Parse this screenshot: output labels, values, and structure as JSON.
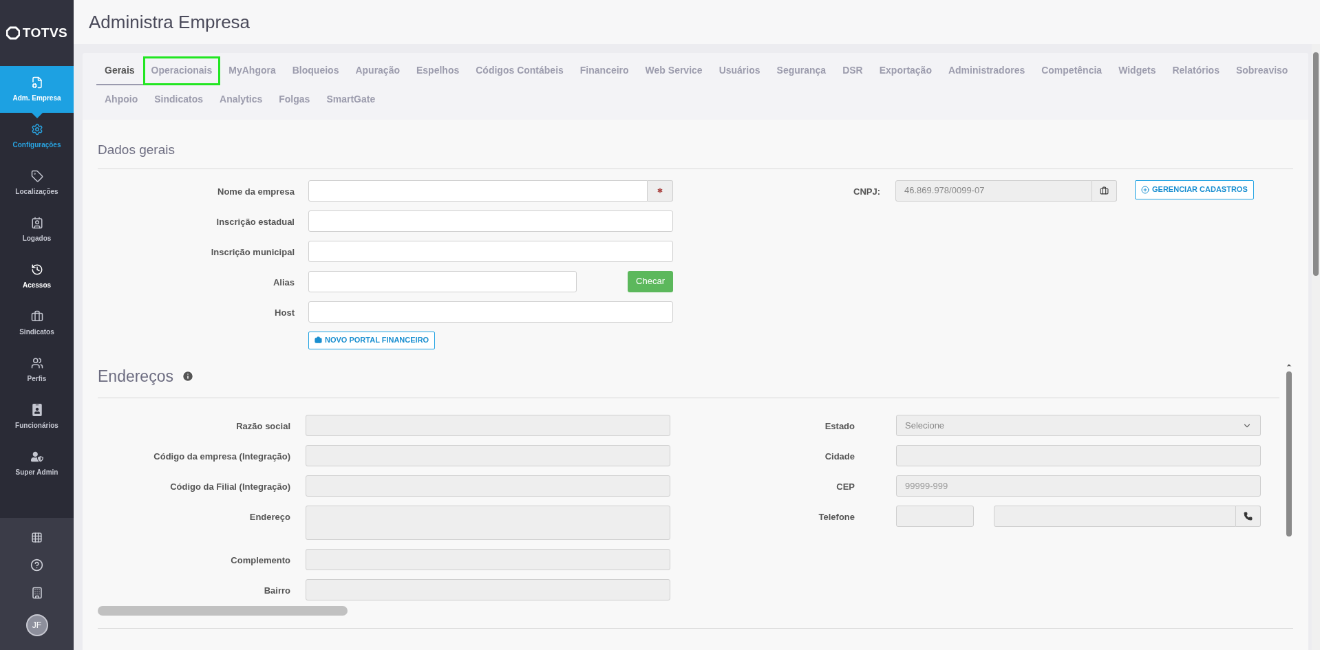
{
  "sidebar": {
    "logo": "TOTVS",
    "items": [
      {
        "label": "Adm. Empresa",
        "selected": true,
        "color": "#ffffff"
      },
      {
        "label": "Configurações",
        "selected": false,
        "color": "#29a3e0"
      },
      {
        "label": "Localizações",
        "selected": false,
        "color": "#c4c6d0"
      },
      {
        "label": "Logados",
        "selected": false,
        "color": "#c4c6d0"
      },
      {
        "label": "Acessos",
        "selected": false,
        "color": "#ffffff"
      },
      {
        "label": "Sindicatos",
        "selected": false,
        "color": "#c4c6d0"
      },
      {
        "label": "Perfis",
        "selected": false,
        "color": "#c4c6d0"
      },
      {
        "label": "Funcionários",
        "selected": false,
        "color": "#c4c6d0"
      },
      {
        "label": "Super Admin",
        "selected": false,
        "color": "#c4c6d0"
      }
    ],
    "avatar": "JF"
  },
  "header": {
    "title": "Administra Empresa"
  },
  "tab_rows": [
    [
      {
        "label": "Gerais",
        "selected": true,
        "highlighted": false
      },
      {
        "label": "Operacionais",
        "selected": false,
        "highlighted": true
      },
      {
        "label": "MyAhgora",
        "selected": false,
        "highlighted": false
      },
      {
        "label": "Bloqueios",
        "selected": false,
        "highlighted": false
      },
      {
        "label": "Apuração",
        "selected": false,
        "highlighted": false
      },
      {
        "label": "Espelhos",
        "selected": false,
        "highlighted": false
      },
      {
        "label": "Códigos Contábeis",
        "selected": false,
        "highlighted": false
      },
      {
        "label": "Financeiro",
        "selected": false,
        "highlighted": false
      },
      {
        "label": "Web Service",
        "selected": false,
        "highlighted": false
      },
      {
        "label": "Usuários",
        "selected": false,
        "highlighted": false
      },
      {
        "label": "Segurança",
        "selected": false,
        "highlighted": false
      },
      {
        "label": "DSR",
        "selected": false,
        "highlighted": false
      },
      {
        "label": "Exportação",
        "selected": false,
        "highlighted": false
      },
      {
        "label": "Administradores",
        "selected": false,
        "highlighted": false
      },
      {
        "label": "Competência",
        "selected": false,
        "highlighted": false
      },
      {
        "label": "Widgets",
        "selected": false,
        "highlighted": false
      },
      {
        "label": "Relatórios",
        "selected": false,
        "highlighted": false
      },
      {
        "label": "Sobreaviso",
        "selected": false,
        "highlighted": false
      }
    ],
    [
      {
        "label": "Ahpoio",
        "selected": false,
        "highlighted": false
      },
      {
        "label": "Sindicatos",
        "selected": false,
        "highlighted": false
      },
      {
        "label": "Analytics",
        "selected": false,
        "highlighted": false
      },
      {
        "label": "Folgas",
        "selected": false,
        "highlighted": false
      },
      {
        "label": "SmartGate",
        "selected": false,
        "highlighted": false
      }
    ]
  ],
  "dados_gerais": {
    "title": "Dados gerais",
    "fields": [
      {
        "label": "Nome da empresa",
        "kind": "required",
        "disabled": false
      },
      {
        "label": "Inscrição estadual",
        "kind": "text",
        "disabled": false
      },
      {
        "label": "Inscrição municipal",
        "kind": "text",
        "disabled": false
      },
      {
        "label": "Alias",
        "kind": "check",
        "disabled": false,
        "button": "Checar"
      },
      {
        "label": "Host",
        "kind": "text",
        "disabled": false
      }
    ],
    "portal_button": "NOVO PORTAL FINANCEIRO",
    "cnpj": {
      "label": "CNPJ:",
      "value": "46.869.978/0099-07",
      "disabled": true
    },
    "manage_button": "GERENCIAR CADASTROS"
  },
  "enderecos": {
    "title": "Endereços",
    "left_fields": [
      {
        "label": "Razão social",
        "kind": "text",
        "disabled": true
      },
      {
        "label": "Código da empresa (Integração)",
        "kind": "text",
        "disabled": true
      },
      {
        "label": "Código da Filial (Integração)",
        "kind": "text",
        "disabled": true
      },
      {
        "label": "Endereço",
        "kind": "textarea",
        "disabled": true
      },
      {
        "label": "Complemento",
        "kind": "text",
        "disabled": true
      },
      {
        "label": "Bairro",
        "kind": "text",
        "disabled": true
      }
    ],
    "right_fields": [
      {
        "label": "Estado",
        "kind": "select",
        "disabled": true,
        "value": "Selecione"
      },
      {
        "label": "Cidade",
        "kind": "text",
        "disabled": true
      },
      {
        "label": "CEP",
        "kind": "text",
        "disabled": true,
        "placeholder": "99999-999"
      },
      {
        "label": "Telefone",
        "kind": "phone",
        "disabled": true
      }
    ]
  }
}
